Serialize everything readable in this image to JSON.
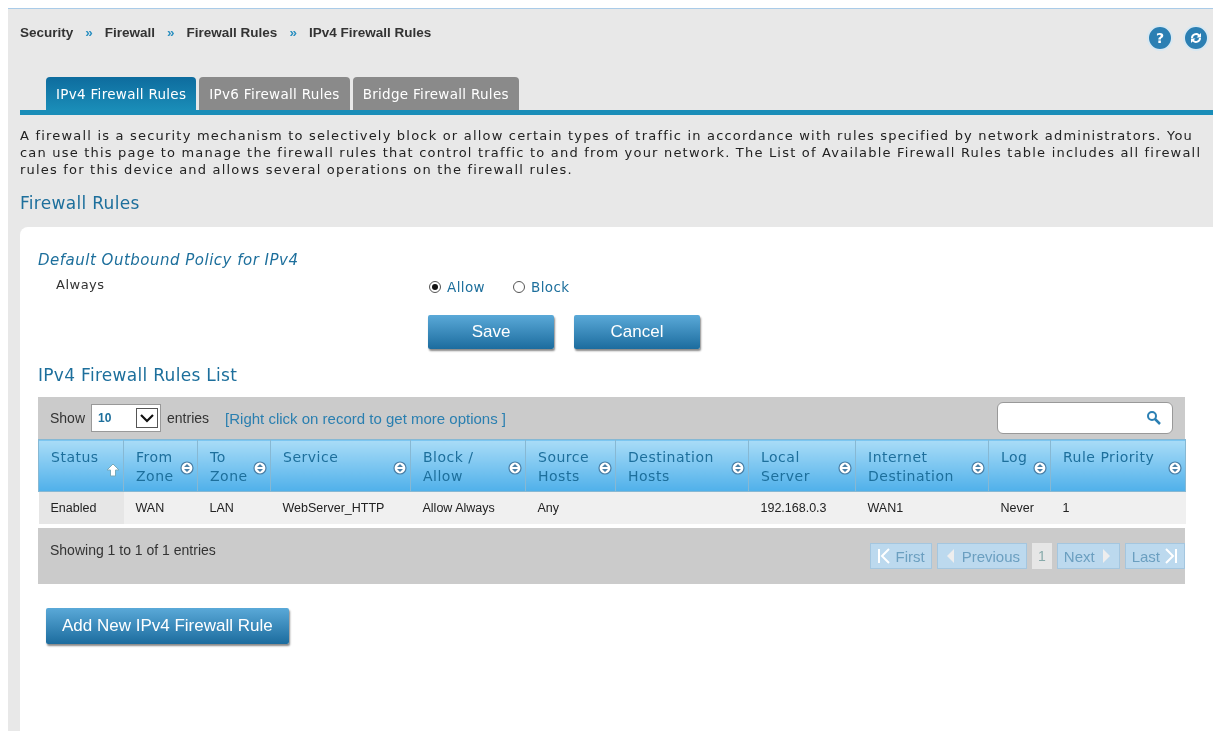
{
  "breadcrumb": [
    "Security",
    "Firewall",
    "Firewall Rules",
    "IPv4 Firewall Rules"
  ],
  "breadcrumb_separator": "»",
  "help_button": {
    "label": "?"
  },
  "tabs": [
    {
      "label": "IPv4 Firewall Rules",
      "selected": true
    },
    {
      "label": "IPv6 Firewall Rules",
      "selected": false
    },
    {
      "label": "Bridge Firewall Rules",
      "selected": false
    }
  ],
  "description": "A firewall is a security mechanism to selectively block or allow certain types of traffic in accordance with rules specified by network administrators. You can use this page to manage the firewall rules that control traffic to and from your network. The List of Available Firewall Rules table includes all firewall rules for this device and allows several operations on the firewall rules.",
  "section_title": "Firewall Rules",
  "policy": {
    "title": "Default Outbound Policy for IPv4",
    "label": "Always",
    "options": [
      {
        "label": "Allow",
        "selected": true
      },
      {
        "label": "Block",
        "selected": false
      }
    ]
  },
  "form_buttons": [
    "Save",
    "Cancel"
  ],
  "list_title": "IPv4 Firewall Rules List",
  "show_entries": {
    "before": "Show",
    "value": "10",
    "after": "entries"
  },
  "hint": "[Right click on record to get more options ]",
  "table": {
    "columns": [
      {
        "label": "Status",
        "sorted": true
      },
      {
        "label": "From Zone",
        "sorted": false
      },
      {
        "label": "To Zone",
        "sorted": false
      },
      {
        "label": "Service",
        "sorted": false
      },
      {
        "label": "Block / Allow",
        "sorted": false
      },
      {
        "label": "Source Hosts",
        "sorted": false
      },
      {
        "label": "Destination Hosts",
        "sorted": false
      },
      {
        "label": "Local Server",
        "sorted": false
      },
      {
        "label": "Internet Destination",
        "sorted": false
      },
      {
        "label": "Log",
        "sorted": false
      },
      {
        "label": "Rule Priority",
        "sorted": false
      }
    ],
    "rows": [
      [
        "Enabled",
        "WAN",
        "LAN",
        "WebServer_HTTP",
        "Allow Always",
        "Any",
        "",
        "192.168.0.3",
        "WAN1",
        "Never",
        "1"
      ]
    ]
  },
  "info": "Showing 1 to 1 of 1 entries",
  "pagination": [
    {
      "kind": "first",
      "label": "First",
      "disabled": true
    },
    {
      "kind": "previous",
      "label": "Previous",
      "disabled": true
    },
    {
      "kind": "page",
      "label": "1",
      "selected": true
    },
    {
      "kind": "next",
      "label": "Next",
      "disabled": true
    },
    {
      "kind": "last",
      "label": "Last",
      "disabled": true
    }
  ],
  "add_button": "Add New IPv4 Firewall Rule"
}
